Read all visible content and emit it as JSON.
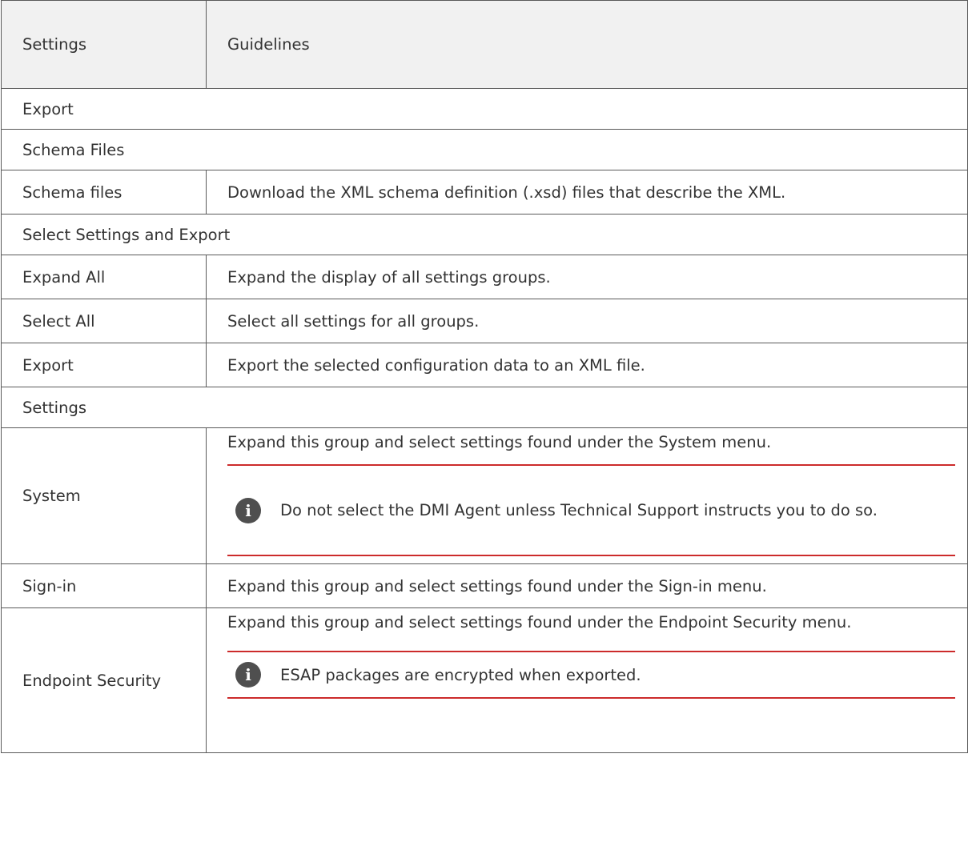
{
  "table": {
    "header": {
      "settings": "Settings",
      "guidelines": "Guidelines"
    },
    "section_export": "Export",
    "section_schema_files": "Schema Files",
    "row_schema_files": {
      "setting": "Schema files",
      "guideline": "Download the XML schema definition (.xsd) files that describe the XML."
    },
    "section_select_settings": "Select Settings and Export",
    "row_expand_all": {
      "setting": "Expand All",
      "guideline": "Expand the display of all settings groups."
    },
    "row_select_all": {
      "setting": "Select All",
      "guideline": "Select all settings for all groups."
    },
    "row_export": {
      "setting": "Export",
      "guideline": "Export the selected configuration data to an XML file."
    },
    "section_settings": "Settings",
    "row_system": {
      "setting": "System",
      "guideline": "Expand this group and select settings found under the System menu.",
      "note": "Do not select the DMI Agent unless Technical Support instructs you to do so."
    },
    "row_sign_in": {
      "setting": "Sign-in",
      "guideline": "Expand this group and select settings found under the Sign-in menu."
    },
    "row_endpoint_security": {
      "setting": "Endpoint Security",
      "guideline": "Expand this group and select settings found under the Endpoint Security menu.",
      "note": "ESAP packages are encrypted when exported."
    }
  },
  "icons": {
    "note": "info-icon"
  },
  "colors": {
    "note_rule": "#cc2b2b",
    "header_bg": "#f1f1f1",
    "icon_bg": "#4f4f4f"
  }
}
